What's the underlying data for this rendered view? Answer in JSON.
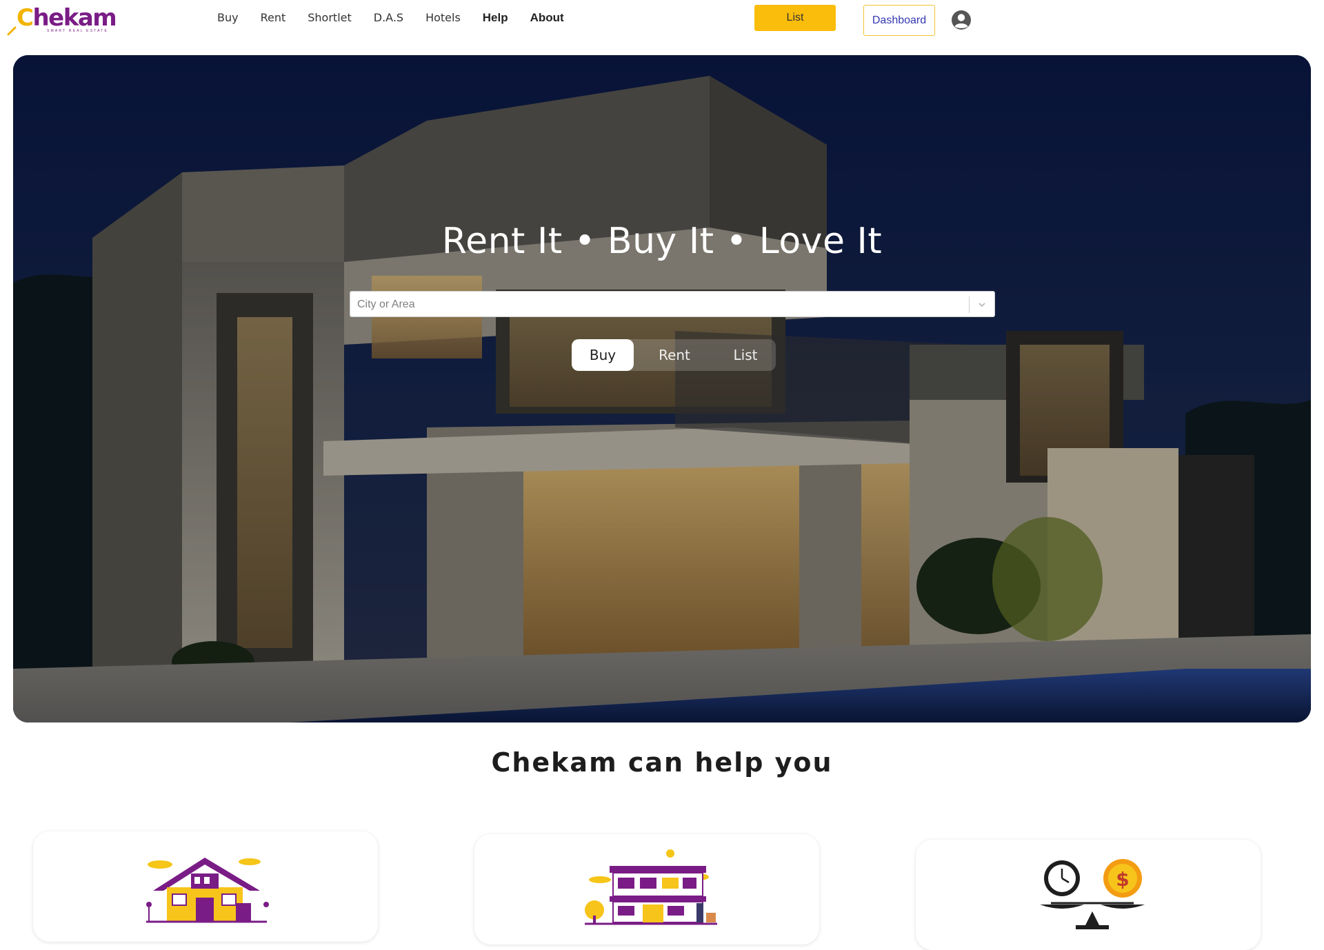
{
  "brand": {
    "name_first": "C",
    "name_rest": "hekam",
    "tagline": "SMART REAL ESTATE",
    "primary_color": "#7a1c86",
    "accent_color": "#fbbd0c"
  },
  "nav": {
    "items": [
      {
        "label": "Buy"
      },
      {
        "label": "Rent"
      },
      {
        "label": "Shortlet"
      },
      {
        "label": "D.A.S"
      },
      {
        "label": "Hotels"
      },
      {
        "label": "Help"
      },
      {
        "label": "About"
      }
    ],
    "list_button": "List",
    "dashboard_button": "Dashboard",
    "user_icon": "user-circle-icon"
  },
  "hero": {
    "title": "Rent It • Buy It • Love It",
    "search": {
      "placeholder": "City or Area",
      "dropdown_icon": "chevron-down-icon"
    },
    "modes": [
      {
        "label": "Buy",
        "active": true
      },
      {
        "label": "Rent",
        "active": false
      },
      {
        "label": "List",
        "active": false
      }
    ]
  },
  "help": {
    "title": "Chekam can help you",
    "cards": [
      {
        "icon": "house-illustration-icon"
      },
      {
        "icon": "building-illustration-icon"
      },
      {
        "icon": "time-money-balance-icon"
      }
    ]
  }
}
